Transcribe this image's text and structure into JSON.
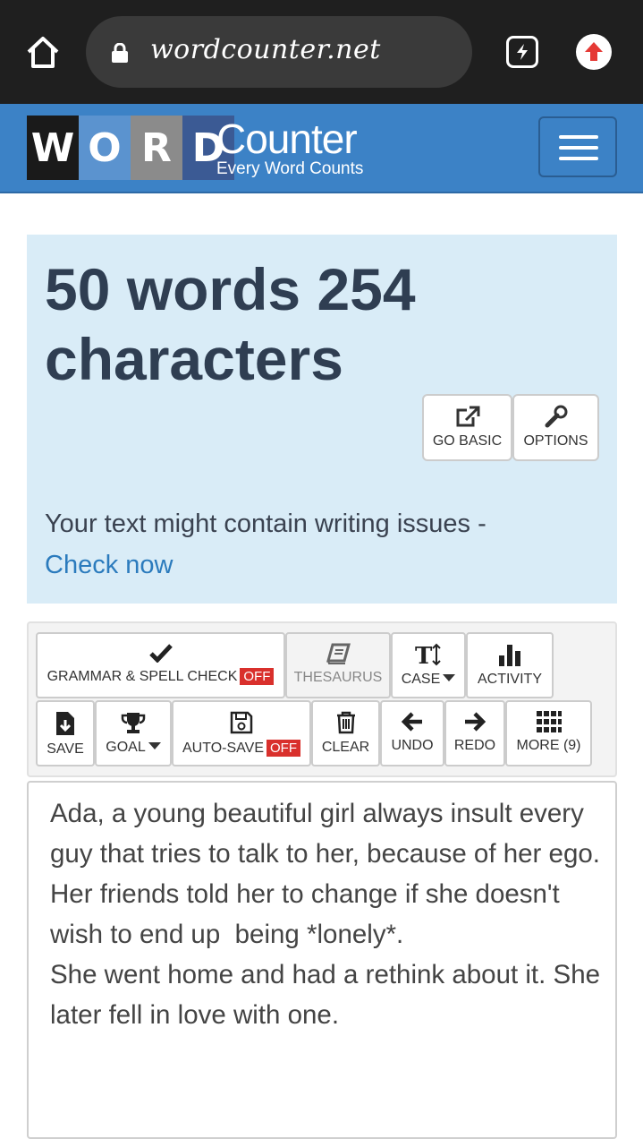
{
  "browser": {
    "url": "wordcounter.net",
    "icons": [
      "home-icon",
      "lock-icon",
      "tabs-icon",
      "update-icon"
    ]
  },
  "site": {
    "logo_letters": [
      "W",
      "O",
      "R",
      "D"
    ],
    "logo_word": "Counter",
    "tagline": "Every Word Counts",
    "colors": {
      "header": "#3c82c6",
      "panel": "#d9ecf7",
      "off_badge": "#d9302c",
      "link": "#2b7bbd"
    }
  },
  "stats": {
    "headline": "50 words 254 characters",
    "go_basic_label": "GO BASIC",
    "options_label": "OPTIONS",
    "issues_text": "Your text might contain writing issues - ",
    "check_now_label": "Check now"
  },
  "toolbar": {
    "grammar_label": "GRAMMAR & SPELL CHECK",
    "grammar_state": "OFF",
    "thesaurus_label": "THESAURUS",
    "case_label": "CASE",
    "activity_label": "ACTIVITY",
    "save_label": "SAVE",
    "goal_label": "GOAL",
    "autosave_label": "AUTO-SAVE",
    "autosave_state": "OFF",
    "clear_label": "CLEAR",
    "undo_label": "UNDO",
    "redo_label": "REDO",
    "more_label": "MORE (9)"
  },
  "editor": {
    "text": "Ada, a young beautiful girl always insult every guy that tries to talk to her, because of her ego. Her friends told her to change if she doesn't wish to end up  being *lonely*.\nShe went home and had a rethink about it. She later fell in love with one."
  }
}
